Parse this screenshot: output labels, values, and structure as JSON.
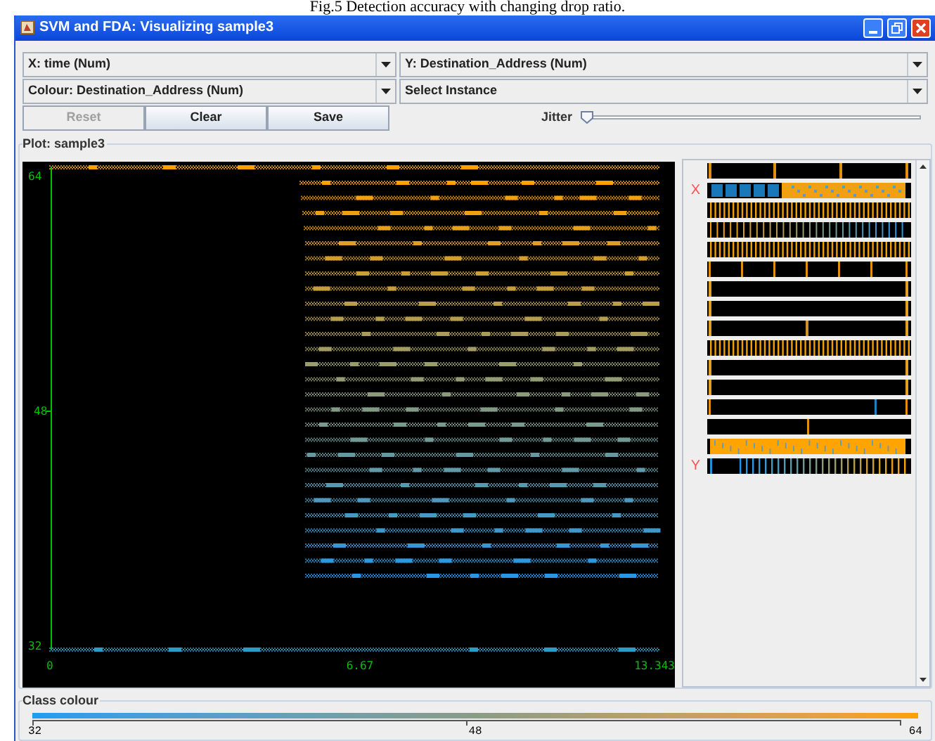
{
  "caption": "Fig.5 Detection accuracy with changing drop ratio.",
  "window": {
    "title": "SVM and FDA: Visualizing sample3"
  },
  "selectors": [
    {
      "text": "X: time (Num)"
    },
    {
      "text": "Y: Destination_Address (Num)"
    },
    {
      "text": "Colour: Destination_Address (Num)"
    },
    {
      "text": "Select Instance"
    }
  ],
  "buttons": [
    {
      "label": "Reset",
      "disabled": true
    },
    {
      "label": "Clear",
      "disabled": false
    },
    {
      "label": "Save",
      "disabled": false
    }
  ],
  "jitter": {
    "label": "Jitter",
    "level": 0
  },
  "plot": {
    "title": "Plot: sample3",
    "x_ticks": [
      "0",
      "6.67",
      "13.343"
    ],
    "y_ticks": [
      "64",
      "48",
      "32"
    ]
  },
  "attributes": [
    {
      "kind": "thirds"
    },
    {
      "kind": "blocks",
      "axis": "X"
    },
    {
      "kind": "dense"
    },
    {
      "kind": "sparse"
    },
    {
      "kind": "dense"
    },
    {
      "kind": "sixths"
    },
    {
      "kind": "ends"
    },
    {
      "kind": "ends"
    },
    {
      "kind": "middle-ends"
    },
    {
      "kind": "dense"
    },
    {
      "kind": "ends"
    },
    {
      "kind": "ends"
    },
    {
      "kind": "ends-blue"
    },
    {
      "kind": "middle"
    },
    {
      "kind": "filled"
    },
    {
      "kind": "gradient",
      "axis": "Y"
    }
  ],
  "class_colour": {
    "title": "Class colour",
    "ticks": [
      "32",
      "48",
      "64"
    ]
  }
}
